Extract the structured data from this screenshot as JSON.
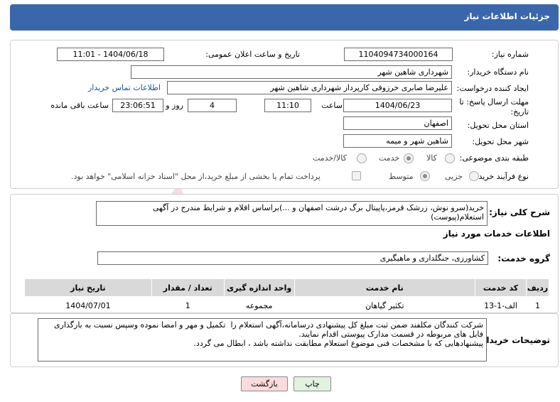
{
  "header": {
    "title": "جزئیات اطلاعات نیاز"
  },
  "form": {
    "need_number_label": "شماره نیاز:",
    "need_number": "1104094734000164",
    "announce_label": "تاریخ و ساعت اعلان عمومی:",
    "announce_value": "1404/06/18 - 11:01",
    "buyer_org_label": "نام دستگاه خریدار:",
    "buyer_org": "شهرداری شاهین شهر",
    "requester_label": "ایجاد کننده درخواست:",
    "requester": "علیرضا صابری خرزوقی کارپرداز شهرداری شاهین شهر",
    "contact_link": "اطلاعات تماس خریدار",
    "deadline_label": "مهلت ارسال پاسخ: تا تاریخ:",
    "deadline_date": "1404/06/23",
    "time_label": "ساعت",
    "deadline_time": "11:10",
    "days_value": "4",
    "days_label": "روز و",
    "remaining_time": "23:06:51",
    "remaining_label": "ساعت باقی مانده",
    "province_label": "استان محل تحویل:",
    "province": "اصفهان",
    "city_label": "شهر محل تحویل:",
    "city": "شاهین شهر و میمه",
    "category_label": "طبقه بندی موضوعی:",
    "category_options": {
      "goods": "کالا",
      "service": "خدمت",
      "goods_service": "کالا/خدمت"
    },
    "process_label": "نوع فرآیند خرید :",
    "process_options": {
      "minor": "جزیی",
      "medium": "متوسط"
    },
    "payment_note": "پرداخت تمام یا بخشی از مبلغ خرید،از محل \"اسناد خزانه اسلامی\" خواهد بود."
  },
  "summary": {
    "label": "شرح کلی نیاز:",
    "text": "خرید(سرو نوش، زرشک قرمز،پاپیتال برگ درشت اصفهان و ...)براساس اقلام و شرایط مندرج در آگهی استعلام(پیوست)"
  },
  "services": {
    "section_title": "اطلاعات خدمات مورد نیاز",
    "group_label": "گروه خدمت:",
    "group_value": "کشاورزی، جنگلداری و ماهیگیری",
    "columns": [
      "ردیف",
      "کد خدمت",
      "نام خدمت",
      "واحد اندازه گیری",
      "تعداد / مقدار",
      "تاریخ نیاز"
    ],
    "rows": [
      {
        "index": "1",
        "code": "الف-1-13",
        "name": "تکثیر گیاهان",
        "unit": "مجموعه",
        "qty": "1",
        "date": "1404/07/01"
      }
    ]
  },
  "notes": {
    "label": "توضیحات خریدار:",
    "text": "شرکت کنندگان مکلفند ضمن ثبت مبلغ کل پیشنهادی درسامانه،آگهی استعلام را  تکمیل و مهر و امضا نموده وسپس نسبت به بارگذاری فایل های مربوطه در قسمت مدارک پیوستی اقدام نمایند.\nپیشنهادهایی که با مشخصات فنی موضوع استعلام مطابقت نداشته باشد ، ابطال می گردد."
  },
  "buttons": {
    "print": "چاپ",
    "back": "بازگشت"
  },
  "watermark": {
    "text": "AriaTender.neT"
  },
  "colors": {
    "header": "#3a67ab",
    "print_button": "#dff3df",
    "back_button": "#fadcdc",
    "link": "#1a4fa5"
  }
}
